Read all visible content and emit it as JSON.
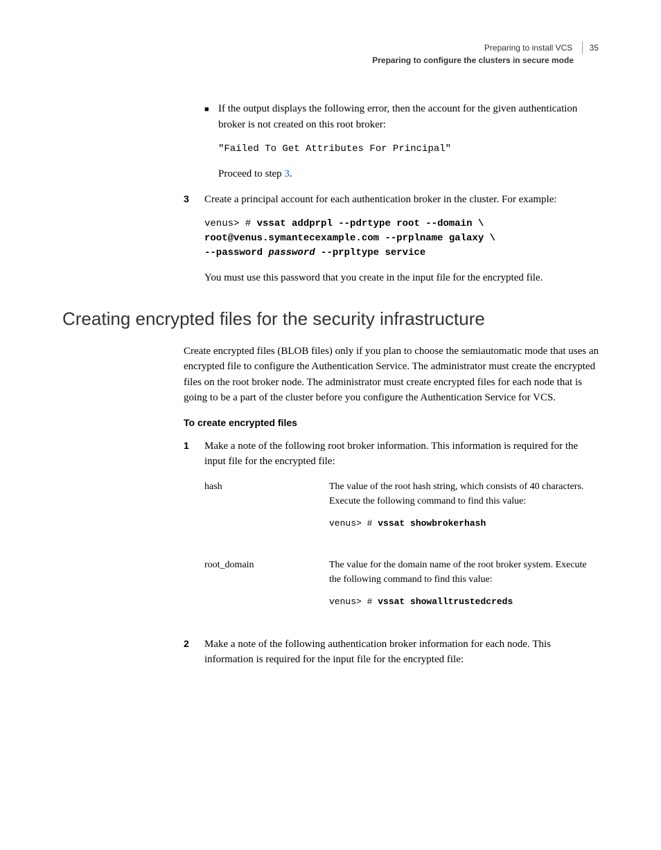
{
  "header": {
    "chapter": "Preparing to install VCS",
    "page": "35",
    "section": "Preparing to configure the clusters in secure mode"
  },
  "bullet1": {
    "text": "If the output displays the following error, then the account for the given authentication broker is not created on this root broker:",
    "code": "\"Failed To Get Attributes For Principal\"",
    "proceed_prefix": "Proceed to step ",
    "proceed_link": "3",
    "proceed_suffix": "."
  },
  "step3": {
    "number": "3",
    "text": "Create a principal account for each authentication broker in the cluster. For example:",
    "code_prefix": "venus> # ",
    "code_line1": "vssat addprpl --pdrtype root --domain \\",
    "code_line2": "root@venus.symantecexample.com --prplname galaxy \\",
    "code_line3_prefix": "--password ",
    "code_line3_italic": "password",
    "code_line3_suffix": " --prpltype service",
    "after": "You must use this password that you create in the input file for the encrypted file."
  },
  "heading": "Creating encrypted files for the security infrastructure",
  "intro": "Create encrypted files (BLOB files) only if you plan to choose the semiautomatic mode that uses an encrypted file to configure the Authentication Service. The administrator must create the encrypted files on the root broker node. The administrator must create encrypted files for each node that is going to be a part of the cluster before you configure the Authentication Service for VCS.",
  "subheading": "To create encrypted files",
  "step1": {
    "number": "1",
    "text": "Make a note of the following root broker information. This information is required for the input file for the encrypted file:",
    "rows": [
      {
        "term": "hash",
        "desc": "The value of the root hash string, which consists of 40 characters. Execute the following command to find this value:",
        "code_prefix": "venus> # ",
        "code_bold": "vssat showbrokerhash"
      },
      {
        "term": "root_domain",
        "desc": "The value for the domain name of the root broker system. Execute the following command to find this value:",
        "code_prefix": "venus> # ",
        "code_bold": "vssat showalltrustedcreds"
      }
    ]
  },
  "step2": {
    "number": "2",
    "text": "Make a note of the following authentication broker information for each node. This information is required for the input file for the encrypted file:"
  }
}
